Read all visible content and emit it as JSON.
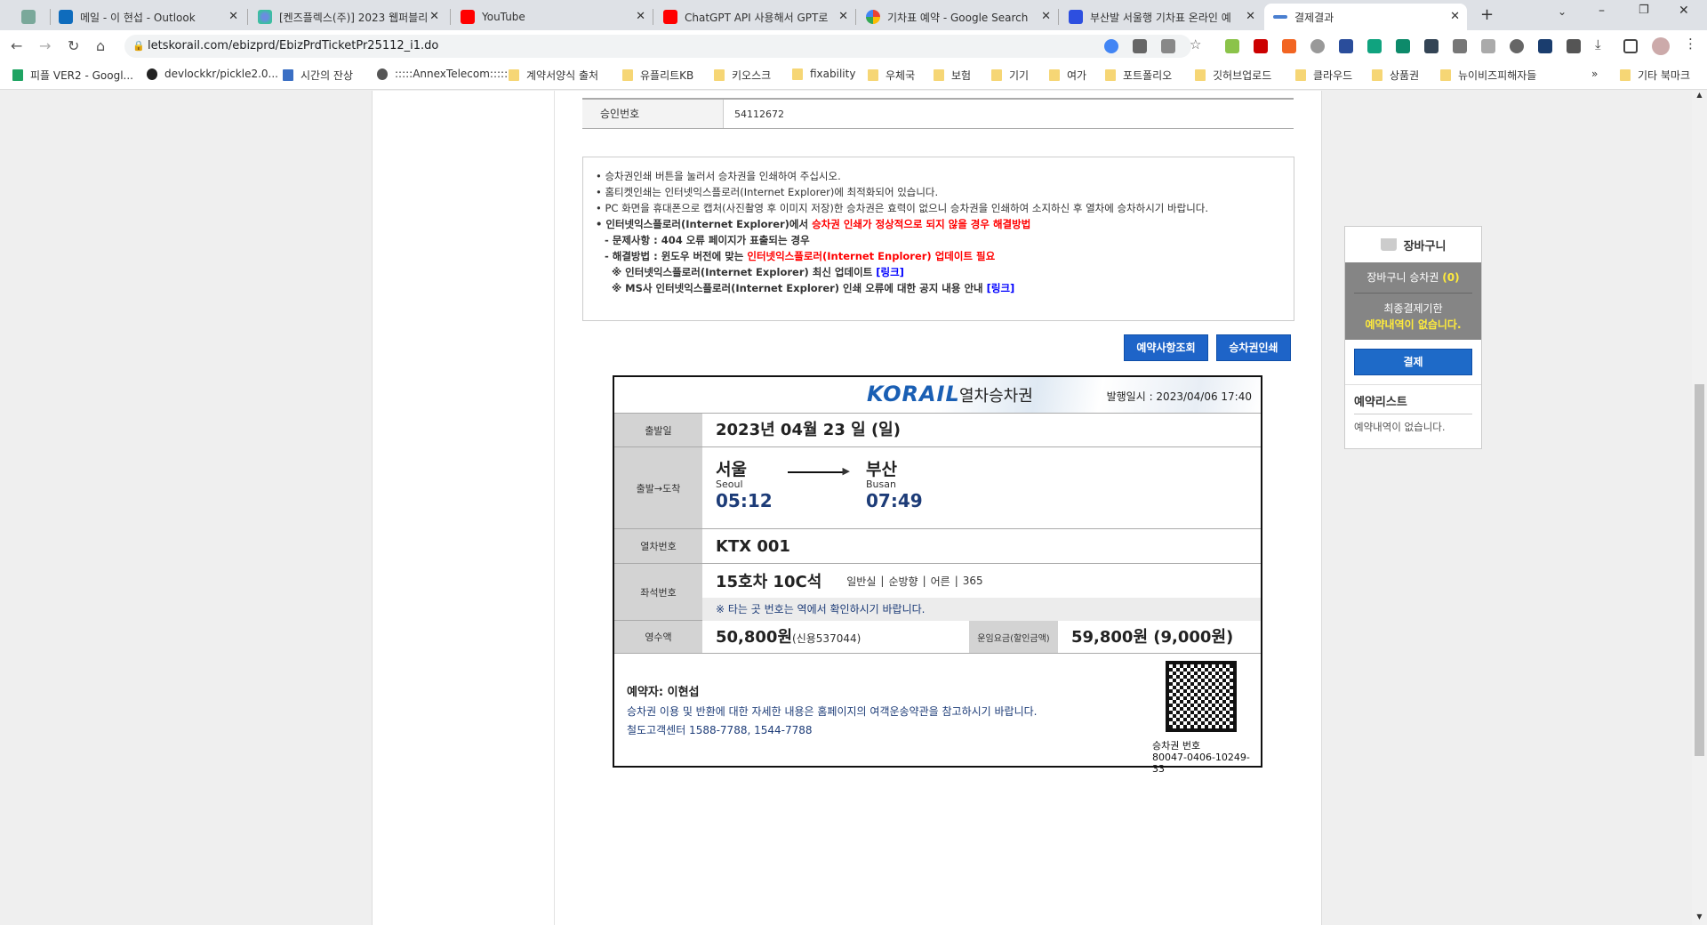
{
  "browser": {
    "tabs": [
      {
        "title": "",
        "icon": "chatgpt-icon"
      },
      {
        "title": "메일 - 이 현섭 - Outlook",
        "icon": "outlook-icon"
      },
      {
        "title": "[켄즈플렉스(주)] 2023 웹퍼블리",
        "icon": "dots-icon"
      },
      {
        "title": "YouTube",
        "icon": "youtube-icon"
      },
      {
        "title": "ChatGPT API 사용해서 GPT로",
        "icon": "youtube-icon"
      },
      {
        "title": "기차표 예약 - Google Search",
        "icon": "google-icon"
      },
      {
        "title": "부산발 서울행 기차표 온라인 예",
        "icon": "t-icon"
      },
      {
        "title": "결제결과",
        "icon": "korail-icon"
      }
    ],
    "url": "letskorail.com/ebizprd/EbizPrdTicketPr25112_i1.do",
    "bookmarks": [
      "피플 VER2 - Googl...",
      "devlockkr/pickle2.0...",
      "시간의 잔상",
      ":::::AnnexTelecom:::::",
      "계약서양식 출처",
      "유플리트KB",
      "키오스크",
      "fixability",
      "우체국",
      "보험",
      "기기",
      "여가",
      "포트폴리오",
      "깃허브업로드",
      "클라우드",
      "상품권",
      "뉴이비즈피해자들"
    ],
    "other_bookmarks": "기타 북마크",
    "more": "»"
  },
  "approval": {
    "label": "승인번호",
    "value": "54112672"
  },
  "notice": {
    "l1": "승차권인쇄 버튼을 눌러서 승차권을 인쇄하여 주십시오.",
    "l2": "홈티켓인쇄는 인터넷익스플로러(Internet Explorer)에 최적화되어 있습니다.",
    "l3": "PC 화면을 휴대폰으로 캡처(사진촬영 후 이미지 저장)한 승차권은 효력이 없으니 승차권을 인쇄하여 소지하신 후 열차에 승차하시기 바랍니다.",
    "l4a": "인터넷익스플로러(Internet Explorer)에서 ",
    "l4b": "승차권 인쇄가 정상적으로 되지 않을 경우 해결방법",
    "l5": "- 문제사항 : 404 오류 페이지가 표출되는 경우",
    "l6a": "- 해결방법 : 윈도우 버전에 맞는 ",
    "l6b": "인터넷익스플로러(Internet Enplorer) 업데이트 필요",
    "l7a": "※ 인터넷익스플로러(Internet Explorer) 최신 업데이트 ",
    "l7b": "[링크]",
    "l8a": "※ MS사 인터넷익스플로러(Internet Explorer) 인쇄 오류에 대한 공지 내용 안내 ",
    "l8b": "[링크]"
  },
  "buttons": {
    "inquiry": "예약사항조회",
    "print": "승차권인쇄"
  },
  "ticket": {
    "logo": "KORAIL",
    "title": "열차승차권",
    "issued": "발행일시 : 2023/04/06 17:40",
    "date_label": "출발일",
    "date": "2023년 04월 23 일 (일)",
    "route_label": "출발→도착",
    "dep": {
      "ko": "서울",
      "en": "Seoul",
      "time": "05:12"
    },
    "arr": {
      "ko": "부산",
      "en": "Busan",
      "time": "07:49"
    },
    "train_label": "열차번호",
    "train": "KTX 001",
    "seat_label": "좌석번호",
    "seat": "15호차 10C석",
    "seat_class": "일반실",
    "seat_dir": "순방향",
    "seat_type": "어른",
    "seat_code": "365",
    "seat_note": "※ 타는 곳 번호는 역에서 확인하시기 바랍니다.",
    "paid_label": "영수액",
    "paid": "50,800원",
    "paid_detail": "(신용537044)",
    "fare_label": "운임요금(할인금액)",
    "fare": "59,800원 (9,000원)",
    "booker": "예약자: 이현섭",
    "info": "승차권 이용 및 반환에 대한 자세한 내용은 홈페이지의 여객운송약관을 참고하시기 바랍니다.",
    "center": "철도고객센터 1588-7788, 1544-7788",
    "ticket_no_label": "승차권 번호",
    "ticket_no": "80047-0406-10249-33"
  },
  "cart": {
    "title": "장바구니",
    "count_label": "장바구니 승차권 ",
    "count": "(0)",
    "deadline": "최종결제기한",
    "deadline_value": "예약내역이 없습니다.",
    "pay": "결제",
    "list_title": "예약리스트",
    "list_empty": "예약내역이 없습니다."
  }
}
